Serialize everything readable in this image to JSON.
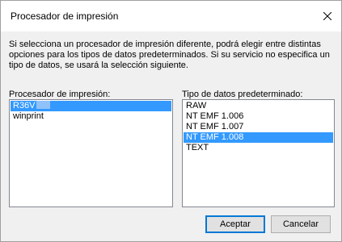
{
  "window": {
    "title": "Procesador de impresión",
    "close_icon": "close-icon"
  },
  "description": "Si selecciona un procesador de impresión diferente, podrá elegir entre distintas opciones para los tipos de datos predeterminados. Si su servicio no especifica un tipo de datos, se usará la selección siguiente.",
  "processor_list": {
    "label": "Procesador de impresión:",
    "items": [
      {
        "label": "R36V",
        "selected": true,
        "redacted_suffix": true
      },
      {
        "label": "winprint",
        "selected": false
      }
    ]
  },
  "datatype_list": {
    "label": "Tipo de datos predeterminado:",
    "items": [
      {
        "label": "RAW",
        "selected": false
      },
      {
        "label": "NT EMF 1.006",
        "selected": false
      },
      {
        "label": "NT EMF 1.007",
        "selected": false
      },
      {
        "label": "NT EMF 1.008",
        "selected": true
      },
      {
        "label": "TEXT",
        "selected": false
      }
    ]
  },
  "buttons": {
    "ok_label": "Aceptar",
    "cancel_label": "Cancelar"
  },
  "colors": {
    "selection": "#3399ff",
    "default_button_border": "#0078d7"
  }
}
